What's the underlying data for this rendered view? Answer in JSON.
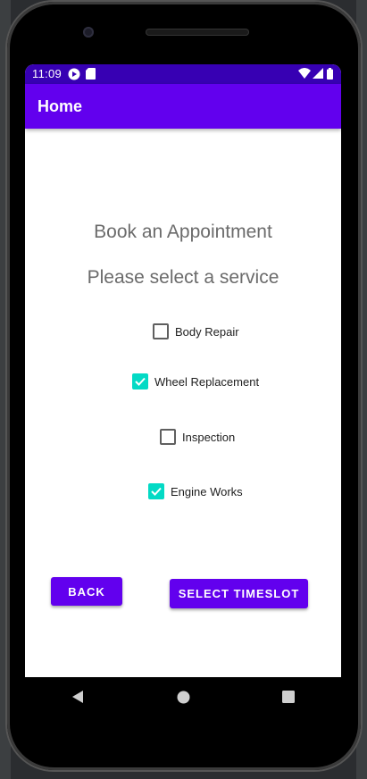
{
  "status_bar": {
    "time": "11:09",
    "icons": [
      "play-protect-icon",
      "sd-card-icon",
      "wifi-icon",
      "signal-icon",
      "battery-icon"
    ]
  },
  "app_bar": {
    "title": "Home"
  },
  "content": {
    "title": "Book an Appointment",
    "subtitle": "Please select a service",
    "services": [
      {
        "label": "Body Repair",
        "checked": false
      },
      {
        "label": "Wheel Replacement",
        "checked": true
      },
      {
        "label": "Inspection",
        "checked": false
      },
      {
        "label": "Engine Works",
        "checked": true
      }
    ],
    "back_label": "BACK",
    "select_label": "SELECT TIMESLOT"
  },
  "nav": {
    "icons": [
      "back-nav-icon",
      "home-nav-icon",
      "recents-nav-icon"
    ]
  },
  "colors": {
    "status_bar": "#3700b3",
    "primary": "#6200ee",
    "checkbox_accent": "#03dac5",
    "heading_text": "#6b6b6b"
  }
}
